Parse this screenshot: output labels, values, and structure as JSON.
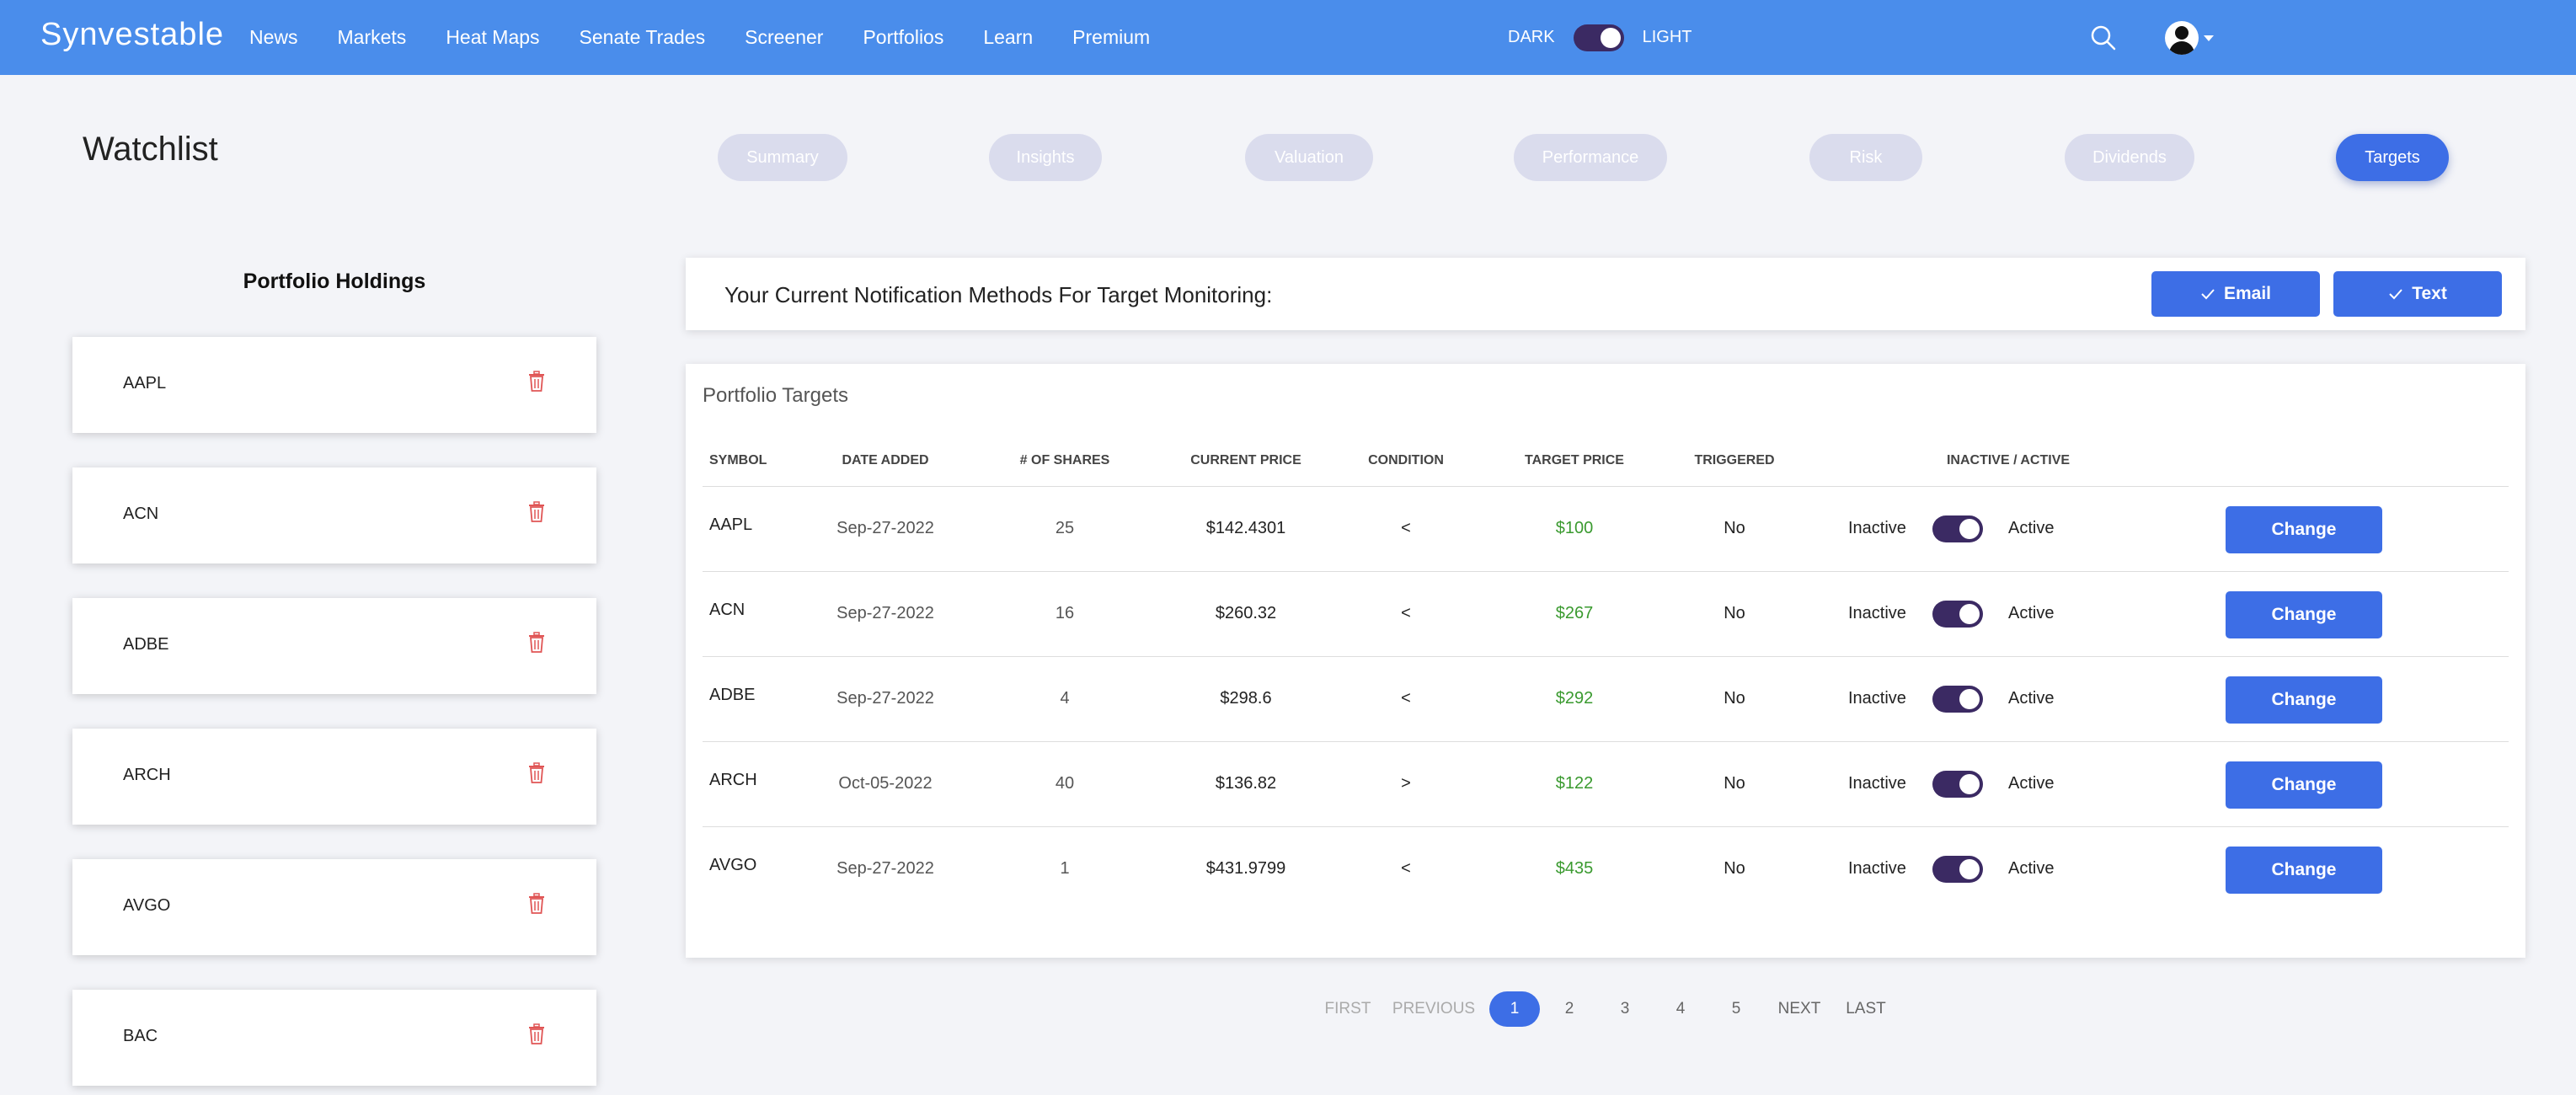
{
  "nav": {
    "brand": "Synvestable",
    "links": [
      "News",
      "Markets",
      "Heat Maps",
      "Senate Trades",
      "Screener",
      "Portfolios",
      "Learn",
      "Premium"
    ],
    "theme_dark": "DARK",
    "theme_light": "LIGHT"
  },
  "page": {
    "title": "Watchlist",
    "tabs": [
      "Summary",
      "Insights",
      "Valuation",
      "Performance",
      "Risk",
      "Dividends",
      "Targets"
    ],
    "active_tab": "Targets"
  },
  "holdings": {
    "title": "Portfolio Holdings",
    "items": [
      "AAPL",
      "ACN",
      "ADBE",
      "ARCH",
      "AVGO",
      "BAC"
    ]
  },
  "notifications": {
    "text": "Your Current Notification Methods For Target Monitoring:",
    "email_label": "Email",
    "text_label": "Text"
  },
  "targets": {
    "title": "Portfolio Targets",
    "columns": {
      "symbol": "SYMBOL",
      "date": "DATE ADDED",
      "shares": "# OF SHARES",
      "price": "CURRENT PRICE",
      "condition": "CONDITION",
      "target": "TARGET PRICE",
      "triggered": "TRIGGERED",
      "status": "INACTIVE / ACTIVE"
    },
    "inactive_label": "Inactive",
    "active_label": "Active",
    "change_label": "Change",
    "rows": [
      {
        "symbol": "AAPL",
        "date": "Sep-27-2022",
        "shares": "25",
        "price": "$142.4301",
        "condition": "<",
        "target": "$100",
        "triggered": "No",
        "active": true
      },
      {
        "symbol": "ACN",
        "date": "Sep-27-2022",
        "shares": "16",
        "price": "$260.32",
        "condition": "<",
        "target": "$267",
        "triggered": "No",
        "active": true
      },
      {
        "symbol": "ADBE",
        "date": "Sep-27-2022",
        "shares": "4",
        "price": "$298.6",
        "condition": "<",
        "target": "$292",
        "triggered": "No",
        "active": true
      },
      {
        "symbol": "ARCH",
        "date": "Oct-05-2022",
        "shares": "40",
        "price": "$136.82",
        "condition": ">",
        "target": "$122",
        "triggered": "No",
        "active": true
      },
      {
        "symbol": "AVGO",
        "date": "Sep-27-2022",
        "shares": "1",
        "price": "$431.9799",
        "condition": "<",
        "target": "$435",
        "triggered": "No",
        "active": true
      }
    ]
  },
  "pagination": {
    "first": "FIRST",
    "previous": "PREVIOUS",
    "pages": [
      "1",
      "2",
      "3",
      "4",
      "5"
    ],
    "current": "1",
    "next": "NEXT",
    "last": "LAST"
  },
  "colors": {
    "navbar": "#4a8deb",
    "accent": "#3d6ee6",
    "toggle": "#3b2a63",
    "target_price": "#3a9a2f",
    "trash": "#e05555"
  }
}
